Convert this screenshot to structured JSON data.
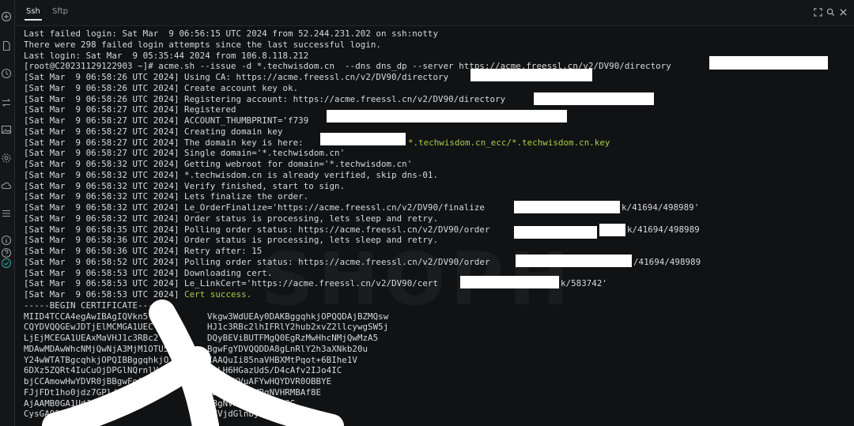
{
  "tabs": [
    {
      "label": "Ssh",
      "active": true
    },
    {
      "label": "Sftp",
      "active": false
    }
  ],
  "sidebar_icons": [
    "add-circle-icon",
    "file-icon",
    "clock-icon",
    "transfer-icon",
    "image-icon",
    "gear-icon",
    "cloud-icon",
    "list-icon",
    "info-icon",
    "help-icon",
    "check-circle-icon"
  ],
  "toolbar_icons": [
    "fullscreen-icon",
    "search-icon",
    "close-icon"
  ],
  "colors": {
    "background": "#111214",
    "text": "#d9d9d9",
    "highlight_green": "#a8cf4a",
    "active_check": "#1e9e8a"
  },
  "terminal": {
    "lines": [
      "Last failed login: Sat Mar  9 06:56:15 UTC 2024 from 52.244.231.202 on ssh:notty",
      "There were 298 failed login attempts since the last successful login.",
      "Last login: Sat Mar  9 05:35:44 2024 from 106.8.118.212",
      "[root@C20231129122903 ~]# acme.sh --issue -d *.techwisdom.cn  --dns dns_dp --server https://acme.freessl.cn/v2/DV90/directory",
      "[Sat Mar  9 06:58:26 UTC 2024] Using CA: https://acme.freessl.cn/v2/DV90/directory",
      "[Sat Mar  9 06:58:26 UTC 2024] Create account key ok.",
      "[Sat Mar  9 06:58:26 UTC 2024] Registering account: https://acme.freessl.cn/v2/DV90/directory",
      "[Sat Mar  9 06:58:27 UTC 2024] Registered",
      "[Sat Mar  9 06:58:27 UTC 2024] ACCOUNT_THUMBPRINT='f739",
      "[Sat Mar  9 06:58:27 UTC 2024] Creating domain key",
      "[Sat Mar  9 06:58:27 UTC 2024] The domain key is here:",
      "[Sat Mar  9 06:58:27 UTC 2024] Single domain='*.techwisdom.cn'",
      "[Sat Mar  9 06:58:32 UTC 2024] Getting webroot for domain='*.techwisdom.cn'",
      "[Sat Mar  9 06:58:32 UTC 2024] *.techwisdom.cn is already verified, skip dns-01.",
      "[Sat Mar  9 06:58:32 UTC 2024] Verify finished, start to sign.",
      "[Sat Mar  9 06:58:32 UTC 2024] Lets finalize the order.",
      "[Sat Mar  9 06:58:32 UTC 2024] Le_OrderFinalize='https://acme.freessl.cn/v2/DV90/finalize",
      "[Sat Mar  9 06:58:32 UTC 2024] Order status is processing, lets sleep and retry.",
      "[Sat Mar  9 06:58:35 UTC 2024] Polling order status: https://acme.freessl.cn/v2/DV90/order",
      "[Sat Mar  9 06:58:36 UTC 2024] Order status is processing, lets sleep and retry.",
      "[Sat Mar  9 06:58:36 UTC 2024] Retry after: 15",
      "[Sat Mar  9 06:58:52 UTC 2024] Polling order status: https://acme.freessl.cn/v2/DV90/order",
      "[Sat Mar  9 06:58:53 UTC 2024] Downloading cert.",
      "[Sat Mar  9 06:58:53 UTC 2024] Le_LinkCert='https://acme.freessl.cn/v2/DV90/cert",
      "[Sat Mar  9 06:58:53 UTC 2024] ",
      "-----BEGIN CERTIFICATE-----",
      "MIID4TCCA4egAwIBAgIQVkn5",
      "CQYDVQQGEwJDTjElMCMGA1UEC",
      "LjEjMCEGA1UEAxMaVHJ1c3RBc2",
      "MDAwMDAwWhcNMjQwNjA3MjM1OTU5",
      "Y24wWTATBgcqhkjOPQIBBggqhkjO",
      "6DXz5ZQRt4IuCuOjDPGlNQrnlV",
      "bjCCAmowHwYDVR0jBBgwFoAU",
      "FJjFDt1ho0jdz7GPl/yqU",
      "AjAAMB0GA1UdJQQWMBQ",
      "CysGAQOBsjEBAg"
    ],
    "line_tails": [
      "",
      "",
      "",
      "",
      "",
      "",
      "",
      "",
      "",
      "",
      "*.techwisdom.cn_ecc/*.techwisdom.cn.key",
      "",
      "",
      "",
      "",
      "",
      "k/41694/498989'",
      "",
      "k/41694/498989",
      "",
      "",
      "/41694/498989",
      "",
      "k/583742'",
      "Cert success.",
      "",
      "Vkgw3WdUEAy0DAKBggqhkjOPQQDAjBZMQsw",
      "HJ1c3RBc2lhIFRlY2hub2xvZ2llcywgSW5j",
      "DQyBEViBUTFMgQ0EgRzMwHhcNMjQwMzA5",
      "BgwFgYDVQQDDA8gLnRlY2h3aXNkb20u",
      "CAAQuIi85naVHBXMtPqot+6BIhe1V",
      "GcLH6HGazUdS/D4cAfv2IJo4IC",
      "V9OGIKVuAFYwHQYDVR0OBBYE",
      "OEAwIHgDAMBgNVHRMBAf8E",
      "JBgNVHSAEQjBAMDQG",
      "ZFVjdGlnby5jb20v"
    ],
    "green_line_index": 24
  }
}
